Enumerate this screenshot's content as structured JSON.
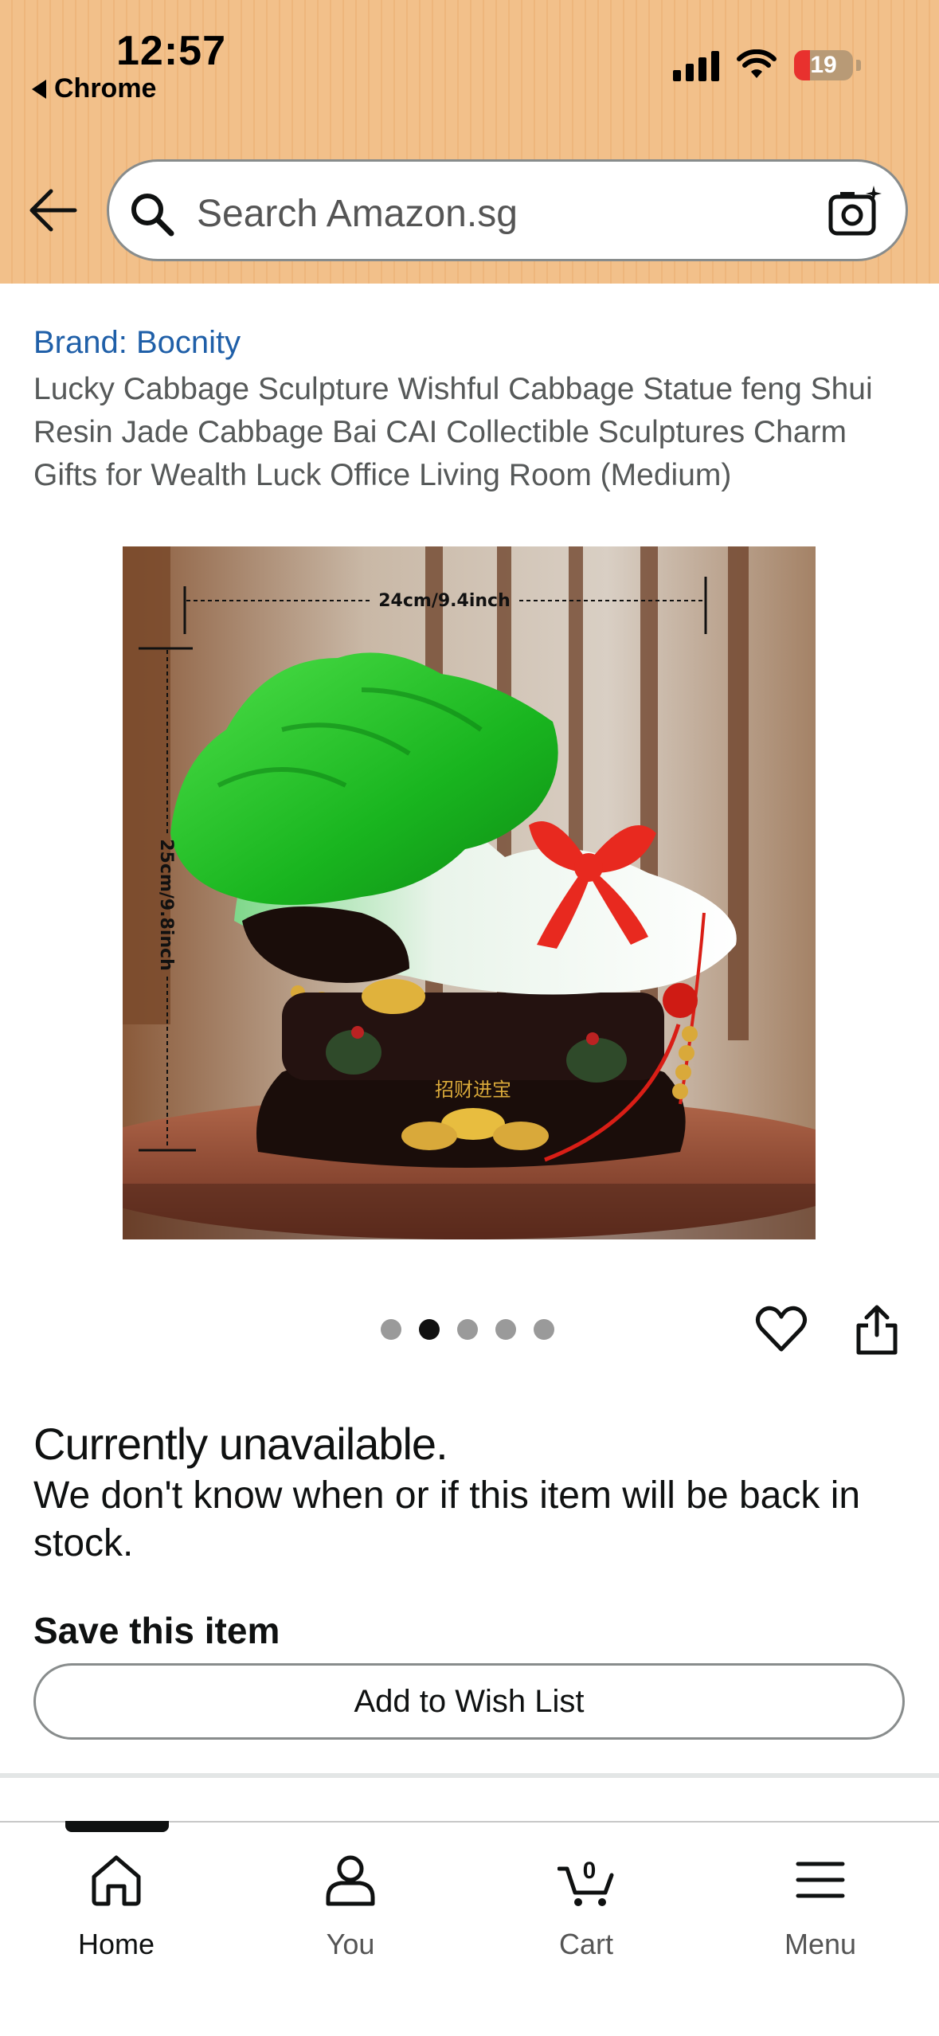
{
  "status_bar": {
    "time": "12:57",
    "back_app": "Chrome",
    "battery": "19"
  },
  "search": {
    "placeholder": "Search Amazon.sg"
  },
  "product": {
    "brand": "Brand: Bocnity",
    "title": "Lucky Cabbage Sculpture Wishful Cabbage Statue feng Shui Resin Jade Cabbage Bai CAI Collectible Sculptures Charm Gifts for Wealth Luck Office Living Room (Medium)",
    "image": {
      "width_label": "24cm/9.4inch",
      "height_label": "25cm/9.8inch",
      "base_text": "招财进宝"
    },
    "carousel": {
      "count": 5,
      "active_index": 1
    }
  },
  "availability": {
    "heading": "Currently unavailable.",
    "message": "We don't know when or if this item will be back in stock."
  },
  "save": {
    "heading": "Save this item",
    "button_label": "Add to Wish List"
  },
  "bottom_nav": {
    "items": [
      {
        "label": "Home",
        "icon": "home-icon",
        "active": true
      },
      {
        "label": "You",
        "icon": "person-icon"
      },
      {
        "label": "Cart",
        "icon": "cart-icon",
        "badge": "0"
      },
      {
        "label": "Menu",
        "icon": "menu-icon"
      }
    ]
  },
  "colors": {
    "header_bg": "#f2c08a",
    "brand_link": "#1f5fa8",
    "text_primary": "#0f1111",
    "text_secondary": "#565959"
  }
}
